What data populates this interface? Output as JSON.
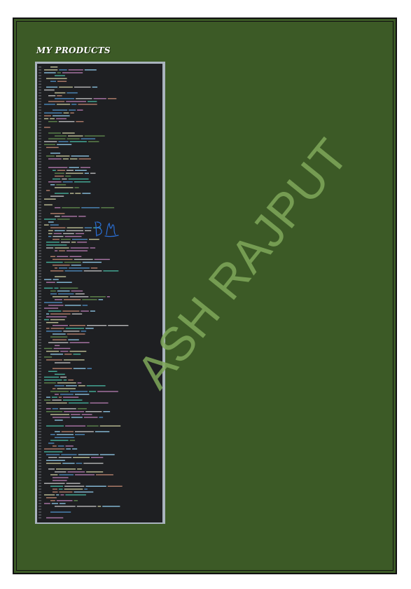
{
  "page": {
    "title": "MY PRODUCTS",
    "watermark": "ASH RAJPUT"
  },
  "screenshot": {
    "description_icon": "code-screenshot-image",
    "signature_icon": "handwritten-signature"
  },
  "colors": {
    "background_frame": "#3c5a26",
    "watermark": "#7fa85a",
    "code_background": "#1e1f22",
    "signature": "#2a6fd6"
  }
}
